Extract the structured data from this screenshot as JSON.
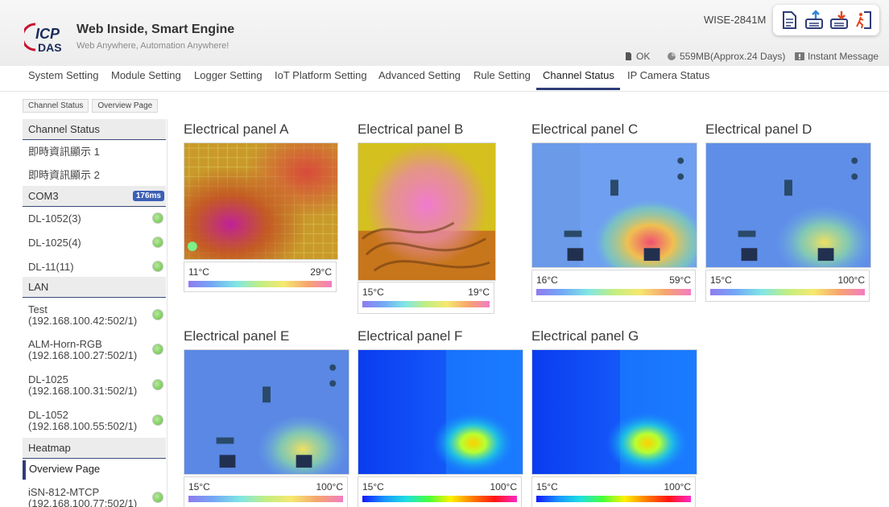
{
  "header": {
    "logo_text": "ICP DAS",
    "brand_title": "Web Inside, Smart Engine",
    "brand_slogan": "Web Anywhere, Automation Anywhere!",
    "model": "WISE-2841M",
    "icons": [
      "document-icon",
      "upload-icon",
      "download-icon",
      "logout-icon"
    ],
    "status": {
      "sd_card": "OK",
      "storage": "559MB(Approx.24 Days)",
      "message": "Instant Message"
    }
  },
  "nav": {
    "tabs": [
      {
        "id": "system-setting",
        "label": "System Setting"
      },
      {
        "id": "module-setting",
        "label": "Module Setting"
      },
      {
        "id": "logger-setting",
        "label": "Logger Setting"
      },
      {
        "id": "iot-platform-setting",
        "label": "IoT Platform Setting"
      },
      {
        "id": "advanced-setting",
        "label": "Advanced Setting"
      },
      {
        "id": "rule-setting",
        "label": "Rule Setting"
      },
      {
        "id": "channel-status",
        "label": "Channel Status",
        "active": true
      },
      {
        "id": "ip-camera-status",
        "label": "IP Camera Status"
      }
    ]
  },
  "breadcrumb": [
    "Channel Status",
    "Overview Page"
  ],
  "sidebar": {
    "channel_status": "Channel Status",
    "realtime_1": "即時資訊顯示 1",
    "realtime_2": "即時資訊顯示 2",
    "com3": "COM3",
    "com3_badge": "176ms",
    "com_items": [
      "DL-1052(3)",
      "DL-1025(4)",
      "DL-11(11)"
    ],
    "lan": "LAN",
    "lan_items": [
      {
        "name": "Test",
        "ip": "(192.168.100.42:502/1)"
      },
      {
        "name": "ALM-Horn-RGB",
        "ip": "(192.168.100.27:502/1)"
      },
      {
        "name": "DL-1025",
        "ip": "(192.168.100.31:502/1)"
      },
      {
        "name": "DL-1052",
        "ip": "(192.168.100.55:502/1)"
      }
    ],
    "heatmap": "Heatmap",
    "overview": "Overview Page",
    "extra": {
      "name": "iSN-812-MTCP",
      "ip": "(192.168.100.77:502/1)"
    }
  },
  "panels": [
    {
      "title": "Electrical panel A",
      "min": "11°C",
      "max": "29°C"
    },
    {
      "title": "Electrical panel B",
      "min": "15°C",
      "max": "19°C"
    },
    {
      "title": "Electrical panel C",
      "min": "16°C",
      "max": "59°C"
    },
    {
      "title": "Electrical panel D",
      "min": "15°C",
      "max": "100°C"
    },
    {
      "title": "Electrical panel E",
      "min": "15°C",
      "max": "100°C"
    },
    {
      "title": "Electrical panel F",
      "min": "15°C",
      "max": "100°C"
    },
    {
      "title": "Electrical panel G",
      "min": "15°C",
      "max": "100°C"
    }
  ],
  "colors": {
    "accent": "#2e3d78",
    "status_ok": "#5fbf3a",
    "badge": "#3b5fb5"
  }
}
